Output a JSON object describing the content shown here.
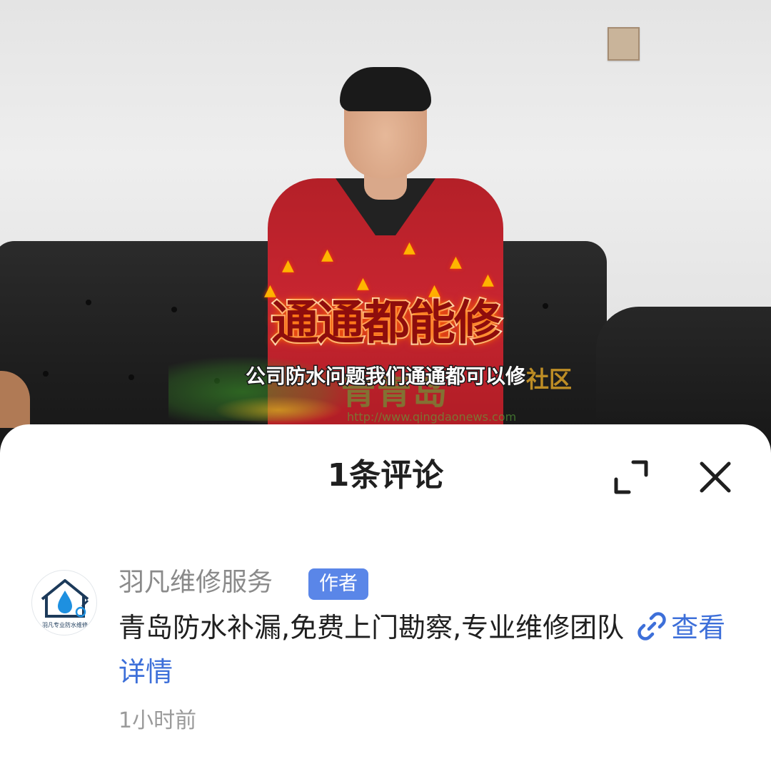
{
  "video": {
    "fire_caption": "通通都能修",
    "subtitle": "公司防水问题我们通通都可以修",
    "watermark": {
      "brand": "青青岛",
      "community": "社区",
      "url": "http://www.qingdaonews.com"
    }
  },
  "comments_sheet": {
    "title": "1条评论",
    "expand_icon": "expand-icon",
    "close_icon": "close-icon"
  },
  "comment": {
    "username": "羽凡维修服务",
    "badge": "作者",
    "avatar_caption": "羽凡专业防水维修",
    "text": "青岛防水补漏,免费上门勘察,专业维修团队",
    "link_label": "查看详情",
    "link_icon": "link-icon",
    "time": "1小时前"
  },
  "colors": {
    "badge": "#5a86e8",
    "link": "#3d6fd9",
    "username": "#8a8a8a"
  }
}
